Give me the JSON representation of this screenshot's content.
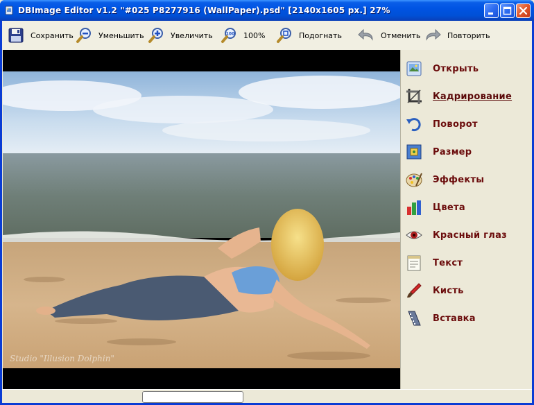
{
  "window": {
    "title": "DBImage Editor v1.2  \"#025 P8277916 (WallPaper).psd\"  [2140x1605 px.]  27%"
  },
  "toolbar": {
    "save_label": "Сохранить",
    "zoom_out_label": "Уменьшить",
    "zoom_in_label": "Увеличить",
    "zoom_100_label": "100%",
    "fit_label": "Подогнать",
    "undo_label": "Отменить",
    "redo_label": "Повторить"
  },
  "image": {
    "watermark": "Studio \"Illusion Dolphin\""
  },
  "sidemenu": {
    "items": [
      {
        "label": "Открыть",
        "icon": "open-image-icon"
      },
      {
        "label": "Кадрирование",
        "icon": "crop-icon",
        "active": true
      },
      {
        "label": "Поворот",
        "icon": "rotate-icon"
      },
      {
        "label": "Размер",
        "icon": "resize-icon"
      },
      {
        "label": "Эффекты",
        "icon": "effects-palette-icon"
      },
      {
        "label": "Цвета",
        "icon": "color-bars-icon"
      },
      {
        "label": "Красный глаз",
        "icon": "red-eye-icon"
      },
      {
        "label": "Текст",
        "icon": "text-notepad-icon"
      },
      {
        "label": "Кисть",
        "icon": "brush-icon"
      },
      {
        "label": "Вставка",
        "icon": "insert-film-icon"
      }
    ]
  },
  "colors": {
    "title_bar": "#0054e3",
    "menu_text": "#6b0c0c",
    "panel_bg": "#ece9d8"
  }
}
